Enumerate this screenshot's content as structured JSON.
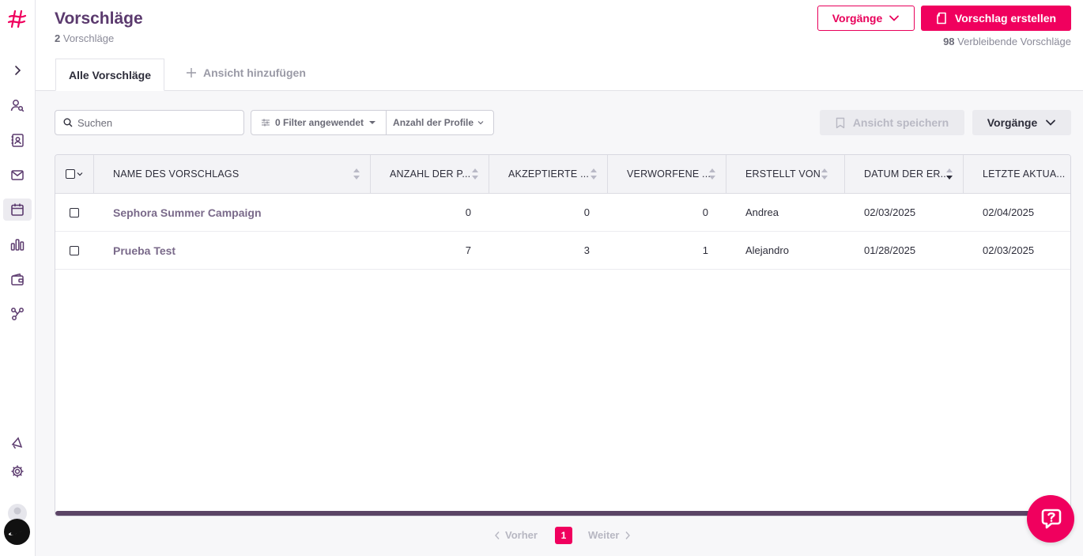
{
  "header": {
    "title": "Vorschläge",
    "count_value": "2",
    "count_label": "Vorschläge",
    "vorgaenge_label": "Vorgänge",
    "create_label": "Vorschlag erstellen",
    "remaining_value": "98",
    "remaining_label": "Verbleibende Vorschläge"
  },
  "tabs": {
    "active_label": "Alle Vorschläge",
    "add_label": "Ansicht hinzufügen"
  },
  "toolbar": {
    "search_placeholder": "Suchen",
    "filter_label": "0 Filter angewendet",
    "profiles_label": "Anzahl der Profile",
    "save_view_label": "Ansicht speichern",
    "vorgaenge_label": "Vorgänge"
  },
  "table": {
    "columns": [
      "NAME DES VORSCHLAGS",
      "ANZAHL DER P...",
      "AKZEPTIERTE ...",
      "VERWORFENE ...",
      "ERSTELLT VON",
      "DATUM DER ER...",
      "LETZTE AKTUA..."
    ],
    "rows": [
      {
        "name": "Sephora Summer Campaign",
        "profiles": "0",
        "accepted": "0",
        "rejected": "0",
        "created_by": "Andrea",
        "created_date": "02/03/2025",
        "updated_date": "02/04/2025"
      },
      {
        "name": "Prueba Test",
        "profiles": "7",
        "accepted": "3",
        "rejected": "1",
        "created_by": "Alejandro",
        "created_date": "01/28/2025",
        "updated_date": "02/03/2025"
      }
    ]
  },
  "pagination": {
    "prev_label": "Vorher",
    "current_page": "1",
    "next_label": "Weiter"
  },
  "colors": {
    "accent": "#f0005e",
    "title": "#5b3a6e",
    "sidebar_icon": "#5b3a6e"
  },
  "icons": {
    "sidebar": [
      "logo-hash-icon",
      "expand-chevron-icon",
      "user-search-icon",
      "contacts-icon",
      "mail-icon",
      "calendar-icon",
      "bar-chart-icon",
      "wallet-icon",
      "network-icon",
      "megaphone-icon",
      "settings-gear-icon"
    ]
  }
}
